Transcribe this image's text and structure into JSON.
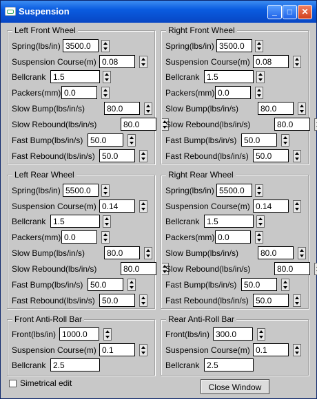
{
  "window": {
    "title": "Suspension",
    "minimize_label": "_",
    "maximize_label": "□",
    "close_label": "✕"
  },
  "groups": {
    "left_front": {
      "title": "Left Front Wheel",
      "fields": [
        {
          "label": "Spring(lbs/in)",
          "value": "3500.0",
          "spinner": true
        },
        {
          "label": "Suspension Course(m)",
          "value": "0.08",
          "spinner": true
        },
        {
          "label": "Bellcrank",
          "value": "1.5",
          "spinner": true
        },
        {
          "label": "Packers(mm)",
          "value": "0.0",
          "spinner": true
        },
        {
          "label": "Slow Bump(lbs/in/s)",
          "value": "80.0",
          "spinner": true
        },
        {
          "label": "Slow Rebound(lbs/in/s)",
          "value": "80.0",
          "spinner": true
        },
        {
          "label": "Fast Bump(lbs/in/s)",
          "value": "50.0",
          "spinner": true
        },
        {
          "label": "Fast Rebound(lbs/in/s)",
          "value": "50.0",
          "spinner": true
        }
      ]
    },
    "right_front": {
      "title": "Right Front Wheel",
      "fields": [
        {
          "label": "Spring(lbs/in)",
          "value": "3500.0",
          "spinner": true
        },
        {
          "label": "Suspension Course(m)",
          "value": "0.08",
          "spinner": true
        },
        {
          "label": "Bellcrank",
          "value": "1.5",
          "spinner": true
        },
        {
          "label": "Packers(mm)",
          "value": "0.0",
          "spinner": true
        },
        {
          "label": "Slow Bump(lbs/in/s)",
          "value": "80.0",
          "spinner": true
        },
        {
          "label": "Slow Rebound(lbs/in/s)",
          "value": "80.0",
          "spinner": true
        },
        {
          "label": "Fast Bump(lbs/in/s)",
          "value": "50.0",
          "spinner": true
        },
        {
          "label": "Fast Rebound(lbs/in/s)",
          "value": "50.0",
          "spinner": true
        }
      ]
    },
    "left_rear": {
      "title": "Left Rear Wheel",
      "fields": [
        {
          "label": "Spring(lbs/in)",
          "value": "5500.0",
          "spinner": true
        },
        {
          "label": "Suspension Course(m)",
          "value": "0.14",
          "spinner": true
        },
        {
          "label": "Bellcrank",
          "value": "1.5",
          "spinner": true
        },
        {
          "label": "Packers(mm)",
          "value": "0.0",
          "spinner": true
        },
        {
          "label": "Slow Bump(lbs/in/s)",
          "value": "80.0",
          "spinner": true
        },
        {
          "label": "Slow Rebound(lbs/in/s)",
          "value": "80.0",
          "spinner": true
        },
        {
          "label": "Fast Bump(lbs/in/s)",
          "value": "50.0",
          "spinner": true
        },
        {
          "label": "Fast Rebound(lbs/in/s)",
          "value": "50.0",
          "spinner": true
        }
      ]
    },
    "right_rear": {
      "title": "Right Rear Wheel",
      "fields": [
        {
          "label": "Spring(lbs/in)",
          "value": "5500.0",
          "spinner": true
        },
        {
          "label": "Suspension Course(m)",
          "value": "0.14",
          "spinner": true
        },
        {
          "label": "Bellcrank",
          "value": "1.5",
          "spinner": true
        },
        {
          "label": "Packers(mm)",
          "value": "0.0",
          "spinner": true
        },
        {
          "label": "Slow Bump(lbs/in/s)",
          "value": "80.0",
          "spinner": true
        },
        {
          "label": "Slow Rebound(lbs/in/s)",
          "value": "80.0",
          "spinner": true
        },
        {
          "label": "Fast Bump(lbs/in/s)",
          "value": "50.0",
          "spinner": true
        },
        {
          "label": "Fast Rebound(lbs/in/s)",
          "value": "50.0",
          "spinner": true
        }
      ]
    },
    "front_antiroll": {
      "title": "Front Anti-Roll Bar",
      "fields": [
        {
          "label": "Front(lbs/in)",
          "value": "1000.0",
          "spinner": true
        },
        {
          "label": "Suspension Course(m)",
          "value": "0.1",
          "spinner": true
        },
        {
          "label": "Bellcrank",
          "value": "2.5",
          "spinner": false
        }
      ]
    },
    "rear_antiroll": {
      "title": "Rear Anti-Roll Bar",
      "fields": [
        {
          "label": "Front(lbs/in)",
          "value": "300.0",
          "spinner": true
        },
        {
          "label": "Suspension Course(m)",
          "value": "0.1",
          "spinner": true
        },
        {
          "label": "Bellcrank",
          "value": "2.5",
          "spinner": false
        }
      ]
    }
  },
  "footer": {
    "symmetrical_label": "Simetrical edit",
    "symmetrical_checked": false,
    "close_button_label": "Close Window"
  }
}
